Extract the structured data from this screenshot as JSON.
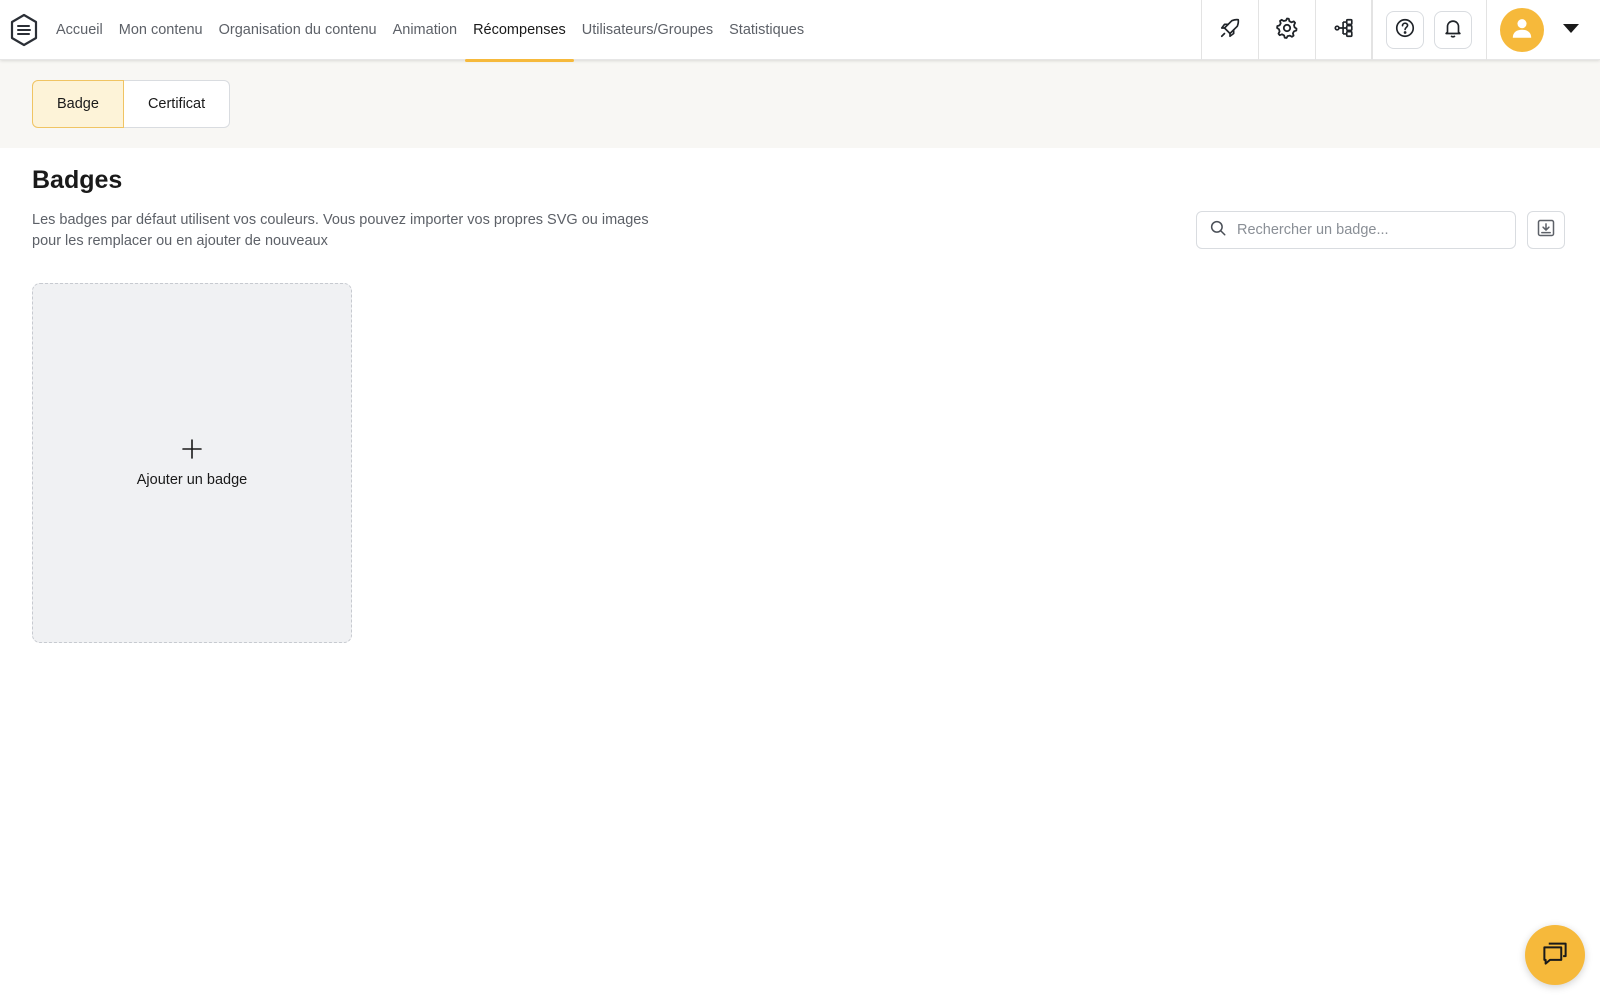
{
  "nav": {
    "items": [
      {
        "label": "Accueil"
      },
      {
        "label": "Mon contenu"
      },
      {
        "label": "Organisation du contenu"
      },
      {
        "label": "Animation"
      },
      {
        "label": "Récompenses"
      },
      {
        "label": "Utilisateurs/Groupes"
      },
      {
        "label": "Statistiques"
      }
    ],
    "active_index": 4
  },
  "toolbar": {
    "icons": [
      "rocket-icon",
      "gear-icon",
      "share-icon",
      "help-icon",
      "bell-icon",
      "user-icon",
      "caret-down-icon"
    ]
  },
  "tabs": {
    "items": [
      {
        "label": "Badge"
      },
      {
        "label": "Certificat"
      }
    ],
    "active_index": 0
  },
  "page": {
    "title": "Badges",
    "description": "Les badges par défaut utilisent vos couleurs. Vous pouvez importer vos propres SVG ou images pour les remplacer ou en ajouter de nouveaux"
  },
  "search": {
    "placeholder": "Rechercher un badge...",
    "value": ""
  },
  "add_card": {
    "label": "Ajouter un badge"
  },
  "colors": {
    "accent": "#f6b93b",
    "active_tab_bg": "#fdf3d8",
    "subheader_bg": "#f8f7f4",
    "card_bg": "#f0f1f3"
  }
}
